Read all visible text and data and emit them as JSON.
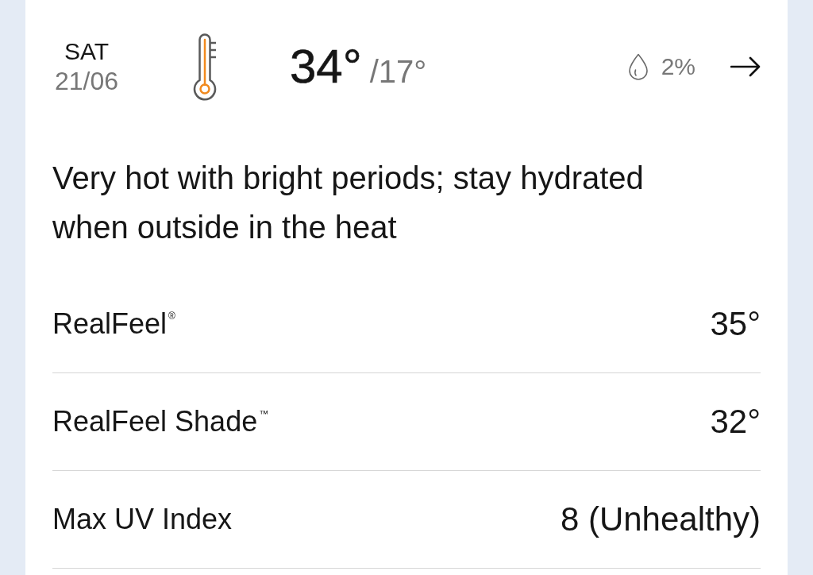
{
  "day": {
    "weekday": "SAT",
    "date": "21/06"
  },
  "temperature": {
    "high": "34°",
    "low": "/17°"
  },
  "precipitation": "2%",
  "description": "Very hot with bright periods; stay hydrated when outside in the heat",
  "details": [
    {
      "label": "RealFeel$^{®}$",
      "value": "35°"
    },
    {
      "label": "RealFeel Shade$^{™}$",
      "value": "32°"
    },
    {
      "label": "Max UV Index",
      "value": "8 (Unhealthy)"
    }
  ]
}
